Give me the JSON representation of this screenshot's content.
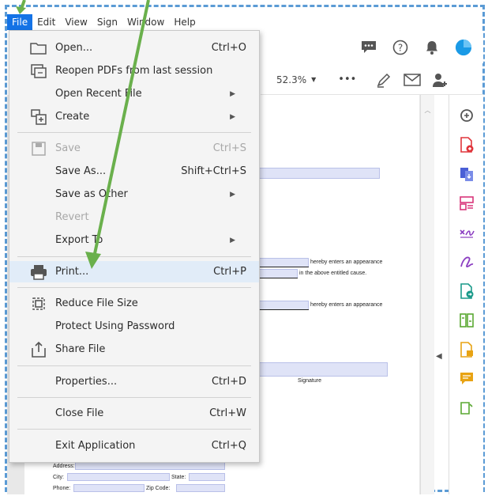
{
  "menubar": {
    "items": [
      "File",
      "Edit",
      "View",
      "Sign",
      "Window",
      "Help"
    ]
  },
  "file_menu": {
    "items": [
      {
        "label": "Open...",
        "shortcut": "Ctrl+O",
        "icon": "folder-icon",
        "state": "enabled"
      },
      {
        "label": "Reopen PDFs from last session",
        "shortcut": "",
        "icon": "reopen-icon",
        "state": "enabled"
      },
      {
        "label": "Open Recent File",
        "shortcut": "",
        "submenu": true,
        "state": "enabled"
      },
      {
        "label": "Create",
        "shortcut": "",
        "submenu": true,
        "icon": "create-icon",
        "state": "enabled"
      },
      {
        "label": "Save",
        "shortcut": "Ctrl+S",
        "icon": "save-icon",
        "state": "disabled"
      },
      {
        "label": "Save As...",
        "shortcut": "Shift+Ctrl+S",
        "state": "enabled"
      },
      {
        "label": "Save as Other",
        "shortcut": "",
        "submenu": true,
        "state": "enabled"
      },
      {
        "label": "Revert",
        "shortcut": "",
        "state": "disabled"
      },
      {
        "label": "Export To",
        "shortcut": "",
        "submenu": true,
        "state": "enabled"
      },
      {
        "label": "Print...",
        "shortcut": "Ctrl+P",
        "icon": "printer-icon",
        "state": "highlighted"
      },
      {
        "label": "Reduce File Size",
        "shortcut": "",
        "icon": "reduce-size-icon",
        "state": "enabled"
      },
      {
        "label": "Protect Using Password",
        "shortcut": "",
        "state": "enabled"
      },
      {
        "label": "Share File",
        "shortcut": "",
        "icon": "share-icon",
        "state": "enabled"
      },
      {
        "label": "Properties...",
        "shortcut": "Ctrl+D",
        "state": "enabled"
      },
      {
        "label": "Close File",
        "shortcut": "Ctrl+W",
        "state": "enabled"
      },
      {
        "label": "Exit Application",
        "shortcut": "Ctrl+Q",
        "state": "enabled"
      }
    ]
  },
  "toolbar": {
    "zoom": "52.3%",
    "more": "•••"
  },
  "page_text": {
    "appearance1": "hereby enters an appearance",
    "cause": "in the above entitled cause.",
    "appearance2": "hereby enters an appearance",
    "signature": "Signature",
    "address": "Address:",
    "city": "City:",
    "state": "State:",
    "phone": "Phone:",
    "zip": "Zip Code:"
  },
  "colors": {
    "accent": "#1473e6",
    "arrow": "#6ab04c",
    "frame": "#5b9bd5"
  }
}
